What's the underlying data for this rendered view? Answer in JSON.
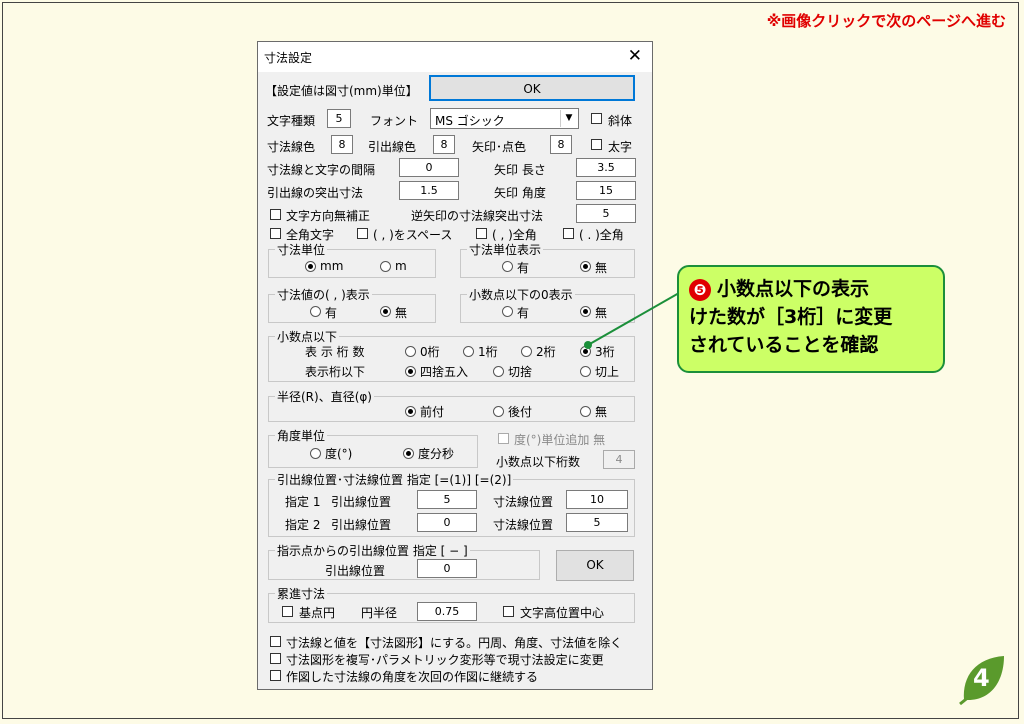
{
  "top_note": "※画像クリックで次のページへ進む",
  "dialog": {
    "title": "寸法設定",
    "unit_note": "【設定値は図寸(mm)単位】",
    "ok_label": "OK",
    "char_type_label": "文字種類",
    "char_type_value": "5",
    "font_label": "フォント",
    "font_value": "MS ゴシック",
    "italic_label": "斜体",
    "dim_color_label": "寸法線色",
    "dim_color_value": "8",
    "leader_color_label": "引出線色",
    "leader_color_value": "8",
    "arrow_color_label": "矢印･点色",
    "arrow_color_value": "8",
    "bold_label": "太字",
    "gap_label": "寸法線と文字の間隔",
    "gap_value": "0",
    "arrow_length_label": "矢印  長さ",
    "arrow_length_value": "3.5",
    "leader_proj_label": "引出線の突出寸法",
    "leader_proj_value": "1.5",
    "arrow_angle_label": "矢印  角度",
    "arrow_angle_value": "15",
    "no_dir_fix_label": "文字方向無補正",
    "rev_arrow_label": "逆矢印の寸法線突出寸法",
    "rev_arrow_value": "5",
    "fullwidth_label": "全角文字",
    "comma_space_label": "( , )をスペース",
    "comma_full_label": "( , )全角",
    "period_full_label": "( . )全角",
    "unit_group": {
      "title": "寸法単位",
      "opt1": "mm",
      "opt2": "m"
    },
    "unit_disp_group": {
      "title": "寸法単位表示",
      "opt1": "有",
      "opt2": "無"
    },
    "comma_disp_group": {
      "title": "寸法値の( , )表示",
      "opt1": "有",
      "opt2": "無"
    },
    "zero_disp_group": {
      "title": "小数点以下の0表示",
      "opt1": "有",
      "opt2": "無"
    },
    "decimal_group": {
      "title": "小数点以下",
      "digits_label": "表 示 桁 数",
      "d0": "0桁",
      "d1": "1桁",
      "d2": "2桁",
      "d3": "3桁",
      "round_label": "表示桁以下",
      "r1": "四捨五入",
      "r2": "切捨",
      "r3": "切上"
    },
    "radius_group": {
      "title": "半径(R)、直径(φ)",
      "o1": "前付",
      "o2": "後付",
      "o3": "無"
    },
    "angle_group": {
      "title": "角度単位",
      "o1": "度(°)",
      "o2": "度分秒"
    },
    "deg_unit_add_label": "度(°)単位追加 無",
    "angle_decimal_label": "小数点以下桁数",
    "angle_decimal_value": "4",
    "leader_pos_group": {
      "title": "引出線位置･寸法線位置  指定 [=(1)] [=(2)]",
      "spec1": "指定 1",
      "spec2": "指定 2",
      "leader_label": "引出線位置",
      "dimline_label": "寸法線位置",
      "s1_leader": "5",
      "s1_dim": "10",
      "s2_leader": "0",
      "s2_dim": "5"
    },
    "from_point_group": {
      "title": "指示点からの引出線位置  指定 [ − ]",
      "leader_label": "引出線位置",
      "value": "0"
    },
    "ok2_label": "OK",
    "cum_group": {
      "title": "累進寸法",
      "base_circle": "基点円",
      "radius_label": "円半径",
      "radius_value": "0.75",
      "text_center": "文字高位置中心"
    },
    "opt_shape": "寸法線と値を【寸法図形】にする。円周、角度、寸法値を除く",
    "opt_copy": "寸法図形を複写･パラメトリック変形等で現寸法設定に変更",
    "opt_continue": "作図した寸法線の角度を次回の作図に継続する"
  },
  "callout": {
    "number": "❺",
    "lines": [
      "小数点以下の表示",
      "けた数が［3桁］に変更",
      "されていることを確認"
    ]
  },
  "page_number": "4",
  "colors": {
    "callout_bg": "#ccff66",
    "callout_border": "#1b8f3a",
    "note_red": "#e00000",
    "leaf_green": "#5a9a2c"
  }
}
